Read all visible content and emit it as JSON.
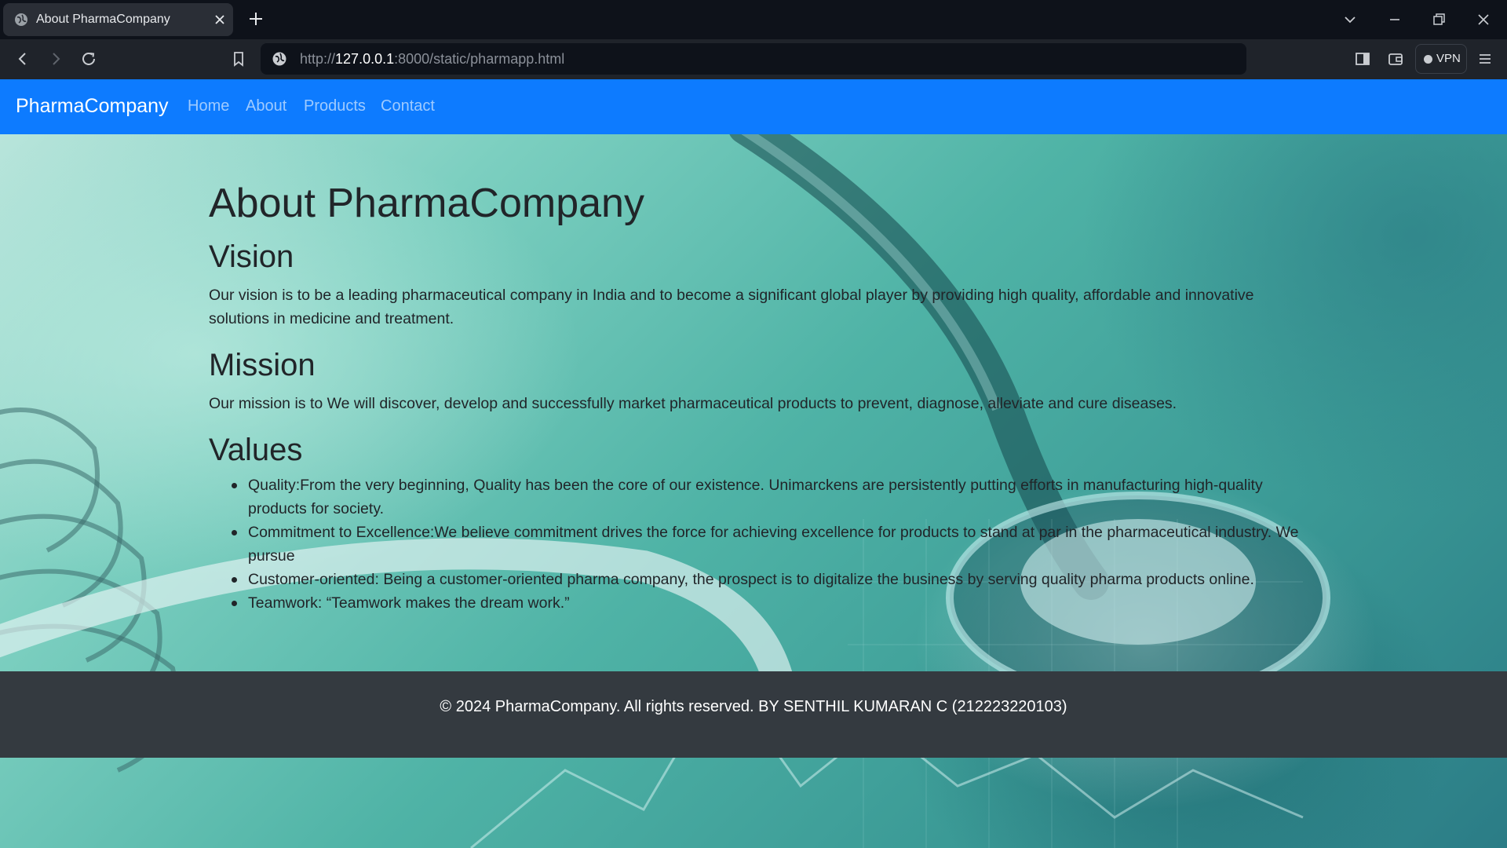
{
  "browser": {
    "tab_title": "About PharmaCompany",
    "url_scheme": "http://",
    "url_host": "127.0.0.1",
    "url_path": ":8000/static/pharmapp.html",
    "vpn_label": "VPN"
  },
  "navbar": {
    "brand": "PharmaCompany",
    "links": [
      "Home",
      "About",
      "Products",
      "Contact"
    ]
  },
  "page": {
    "title": "About PharmaCompany",
    "vision": {
      "heading": "Vision",
      "text": "Our vision is to be a leading pharmaceutical company in India and to become a significant global player by providing high quality, affordable and innovative solutions in medicine and treatment."
    },
    "mission": {
      "heading": "Mission",
      "text": "Our mission is to We will discover, develop and successfully market pharmaceutical products to prevent, diagnose, alleviate and cure diseases."
    },
    "values": {
      "heading": "Values",
      "items": [
        "Quality:From the very beginning, Quality has been the core of our existence. Unimarckens are persistently putting efforts in manufacturing high-quality products for society.",
        "Commitment to Excellence:We believe commitment drives the force for achieving excellence for products to stand at par in the pharmaceutical industry. We pursue",
        "Customer-oriented: Being a customer-oriented pharma company, the prospect is to digitalize the business by serving quality pharma products online.",
        "Teamwork: “Teamwork makes the dream work.”"
      ]
    }
  },
  "footer": {
    "text": "© 2024 PharmaCompany. All rights reserved. BY SENTHIL KUMARAN C (212223220103)"
  },
  "colors": {
    "navbar": "#0d7bff",
    "footer": "#343a40",
    "text": "#212529"
  }
}
